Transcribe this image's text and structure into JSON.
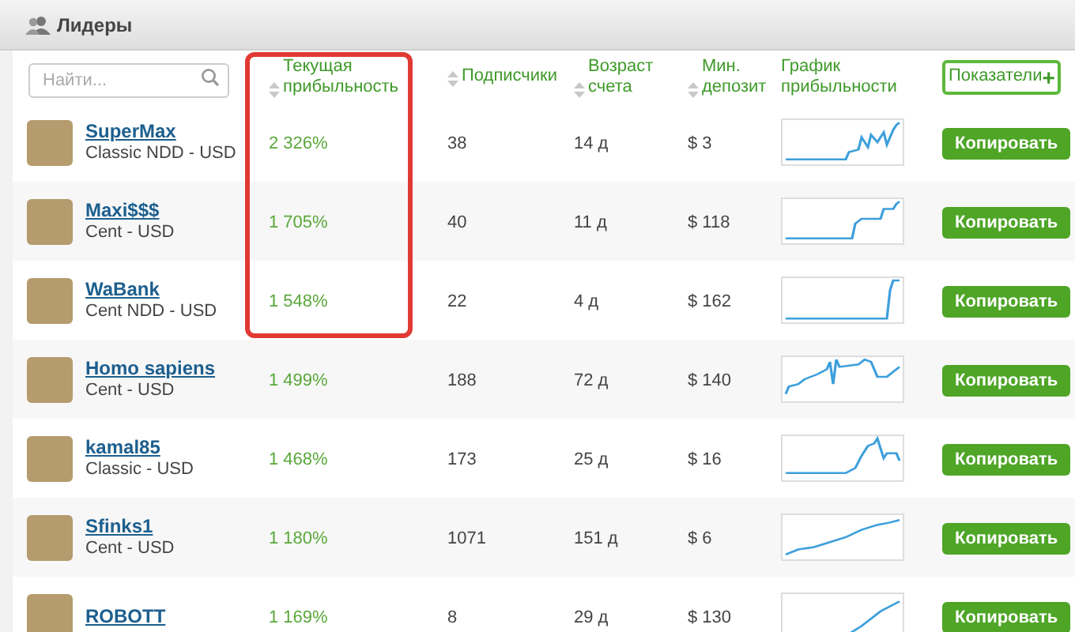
{
  "panel": {
    "title": "Лидеры"
  },
  "search": {
    "placeholder": "Найти..."
  },
  "columns": [
    {
      "label": "Текущая прибыльность",
      "sortable": true,
      "highlighted": true
    },
    {
      "label": "Подписчики",
      "sortable": true,
      "highlighted": false
    },
    {
      "label": "Возраст счета",
      "sortable": true,
      "highlighted": false
    },
    {
      "label": "Мин. депозит",
      "sortable": true,
      "highlighted": false
    },
    {
      "label": "График прибыльности",
      "sortable": false,
      "highlighted": false
    }
  ],
  "indicators_button": {
    "label": "Показатели",
    "icon": "+"
  },
  "rows": [
    {
      "name": "SuperMax",
      "account": "Classic NDD - USD",
      "profit": "2 326%",
      "subscribers": "38",
      "age": "14 д",
      "deposit": "$ 3",
      "action": "Копировать"
    },
    {
      "name": "Maxi$$$",
      "account": "Cent - USD",
      "profit": "1 705%",
      "subscribers": "40",
      "age": "11 д",
      "deposit": "$ 118",
      "action": "Копировать"
    },
    {
      "name": "WaBank",
      "account": "Cent NDD - USD",
      "profit": "1 548%",
      "subscribers": "22",
      "age": "4 д",
      "deposit": "$ 162",
      "action": "Копировать"
    },
    {
      "name": "Homo sapiens",
      "account": "Cent - USD",
      "profit": "1 499%",
      "subscribers": "188",
      "age": "72 д",
      "deposit": "$ 140",
      "action": "Копировать"
    },
    {
      "name": "kamal85",
      "account": "Classic - USD",
      "profit": "1 468%",
      "subscribers": "173",
      "age": "25 д",
      "deposit": "$ 16",
      "action": "Копировать"
    },
    {
      "name": "Sfinks1",
      "account": "Cent - USD",
      "profit": "1 180%",
      "subscribers": "1071",
      "age": "151 д",
      "deposit": "$ 6",
      "action": "Копировать"
    },
    {
      "name": "ROBOTT",
      "profit": "1 169%",
      "subscribers": "8",
      "age": "29 д",
      "deposit": "$ 130",
      "action": "Копировать"
    }
  ]
}
